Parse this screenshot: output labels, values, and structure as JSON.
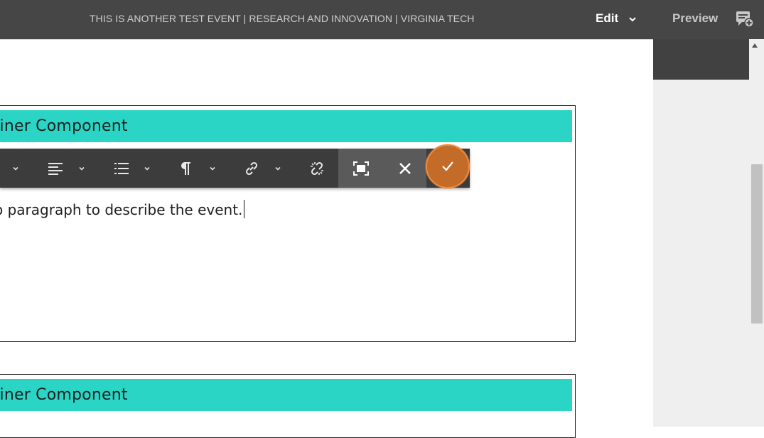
{
  "header": {
    "page_title": "THIS IS ANOTHER TEST EVENT | RESEARCH AND INNOVATION | VIRGINIA TECH",
    "edit_label": "Edit",
    "preview_label": "Preview"
  },
  "components": [
    {
      "title": "tainer Component"
    },
    {
      "title": "tainer Component"
    }
  ],
  "editor": {
    "text": "o paragraph to describe the event."
  },
  "toolbar": {
    "icons": [
      "chevron-down-icon",
      "align-left-icon",
      "chevron-down-icon",
      "list-icon",
      "chevron-down-icon",
      "paragraph-icon",
      "chevron-down-icon",
      "link-icon",
      "chevron-down-icon",
      "unlink-icon",
      "fullscreen-icon",
      "close-icon",
      "check-icon"
    ]
  },
  "colors": {
    "topbar": "#464646",
    "component_header": "#2bd5c5",
    "toolbar": "#3c3c3c",
    "confirm_highlight": "#c36c2a"
  }
}
